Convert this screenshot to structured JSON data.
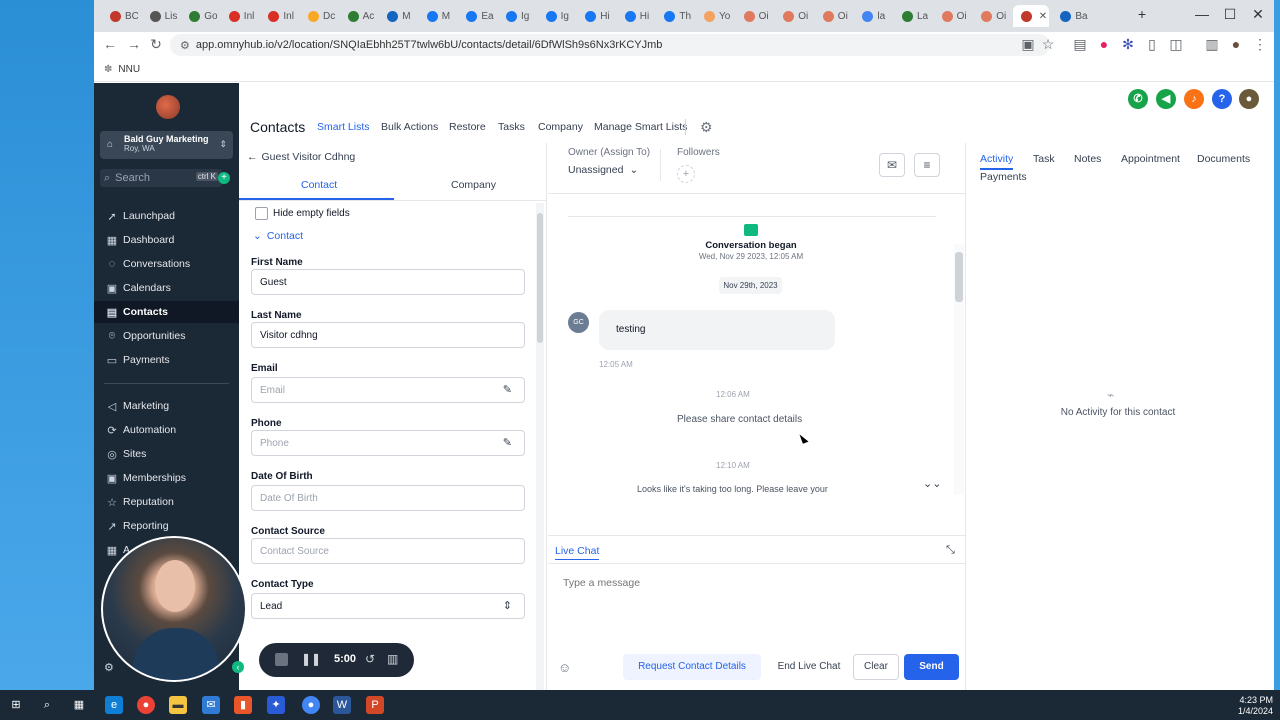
{
  "browser": {
    "tabs": [
      {
        "label": "BC",
        "color": "#c0392b"
      },
      {
        "label": "Lis",
        "color": "#555555"
      },
      {
        "label": "Go",
        "color": "#2e7d32"
      },
      {
        "label": "Inl",
        "color": "#d93025"
      },
      {
        "label": "Inl",
        "color": "#d93025"
      },
      {
        "label": "Dc",
        "color": "#f9a825"
      },
      {
        "label": "Ac",
        "color": "#2e7d32"
      },
      {
        "label": "M",
        "color": "#1565c0"
      },
      {
        "label": "M",
        "color": "#1877f2"
      },
      {
        "label": "Ea",
        "color": "#1877f2"
      },
      {
        "label": "Ig",
        "color": "#1877f2"
      },
      {
        "label": "Ig",
        "color": "#1877f2"
      },
      {
        "label": "Hi",
        "color": "#1877f2"
      },
      {
        "label": "Hi",
        "color": "#1877f2"
      },
      {
        "label": "Th",
        "color": "#1877f2"
      },
      {
        "label": "Yo",
        "color": "#f4a261"
      },
      {
        "label": "Oi",
        "color": "#e07a5f"
      },
      {
        "label": "Oi",
        "color": "#e07a5f"
      },
      {
        "label": "Oi",
        "color": "#e07a5f"
      },
      {
        "label": "la",
        "color": "#4285f4"
      },
      {
        "label": "La",
        "color": "#2e7d32"
      },
      {
        "label": "Oi",
        "color": "#e07a5f"
      },
      {
        "label": "Oi",
        "color": "#e07a5f"
      },
      {
        "label": "",
        "color": "#c0392b"
      },
      {
        "label": "Ba",
        "color": "#1565c0"
      }
    ],
    "url": "app.omnyhub.io/v2/location/SNQIaEbhh25T7twlw6bU/contacts/detail/6DfWlSh9s6Nx3rKCYJmb",
    "bookmark": "NNU"
  },
  "sidebar": {
    "account_name": "Bald Guy Marketing",
    "account_location": "Roy, WA",
    "search_placeholder": "Search",
    "search_shortcut": "ctrl K",
    "items": [
      {
        "label": "Launchpad",
        "icon": "rocket-icon"
      },
      {
        "label": "Dashboard",
        "icon": "grid-icon"
      },
      {
        "label": "Conversations",
        "icon": "chat-icon"
      },
      {
        "label": "Calendars",
        "icon": "calendar-icon"
      },
      {
        "label": "Contacts",
        "icon": "contacts-icon"
      },
      {
        "label": "Opportunities",
        "icon": "funnel-icon"
      },
      {
        "label": "Payments",
        "icon": "card-icon"
      },
      {
        "label": "Marketing",
        "icon": "megaphone-icon"
      },
      {
        "label": "Automation",
        "icon": "automation-icon"
      },
      {
        "label": "Sites",
        "icon": "globe-icon"
      },
      {
        "label": "Memberships",
        "icon": "membership-icon"
      },
      {
        "label": "Reputation",
        "icon": "star-icon"
      },
      {
        "label": "Reporting",
        "icon": "chart-icon"
      },
      {
        "label": "A",
        "icon": "apps-icon"
      }
    ],
    "active": "Contacts"
  },
  "header": {
    "title": "Contacts",
    "nav": [
      "Smart Lists",
      "Bulk Actions",
      "Restore",
      "Tasks",
      "Company",
      "Manage Smart Lists"
    ],
    "active_nav": "Smart Lists"
  },
  "contact": {
    "back_label": "Guest Visitor Cdhng",
    "tabs": [
      "Contact",
      "Company"
    ],
    "hide_empty": "Hide empty fields",
    "section": "Contact",
    "fields": [
      {
        "label": "First Name",
        "value": "Guest",
        "placeholder": ""
      },
      {
        "label": "Last Name",
        "value": "Visitor cdhng",
        "placeholder": ""
      },
      {
        "label": "Email",
        "value": "",
        "placeholder": "Email"
      },
      {
        "label": "Phone",
        "value": "",
        "placeholder": "Phone"
      },
      {
        "label": "Date Of Birth",
        "value": "",
        "placeholder": "Date Of Birth"
      },
      {
        "label": "Contact Source",
        "value": "",
        "placeholder": "Contact Source"
      },
      {
        "label": "Contact Type",
        "value": "Lead",
        "placeholder": ""
      }
    ]
  },
  "conversation": {
    "owner_label": "Owner (Assign To)",
    "owner_value": "Unassigned",
    "followers_label": "Followers",
    "began": "Conversation began",
    "began_date": "Wed, Nov 29 2023, 12:05 AM",
    "date_pill": "Nov 29th, 2023",
    "avatar": "GC",
    "message": "testing",
    "message_time": "12:05 AM",
    "time2": "12:06 AM",
    "system_msg": "Please share contact details",
    "time3": "12:10 AM",
    "cut_msg": "Looks like it's taking too long. Please leave your"
  },
  "live_chat": {
    "title": "Live Chat",
    "placeholder": "Type a message",
    "request": "Request Contact Details",
    "end": "End Live Chat",
    "clear": "Clear",
    "send": "Send"
  },
  "activity": {
    "tabs": [
      "Activity",
      "Task",
      "Notes",
      "Appointment",
      "Documents",
      "Payments"
    ],
    "active": "Activity",
    "empty": "No Activity for this contact"
  },
  "recorder": {
    "time": "5:00"
  },
  "taskbar": {
    "time": "4:23 PM",
    "date": "1/4/2024"
  },
  "colors": {
    "accent": "#2563eb",
    "sidebar": "#1b2836",
    "send": "#2563eb"
  }
}
